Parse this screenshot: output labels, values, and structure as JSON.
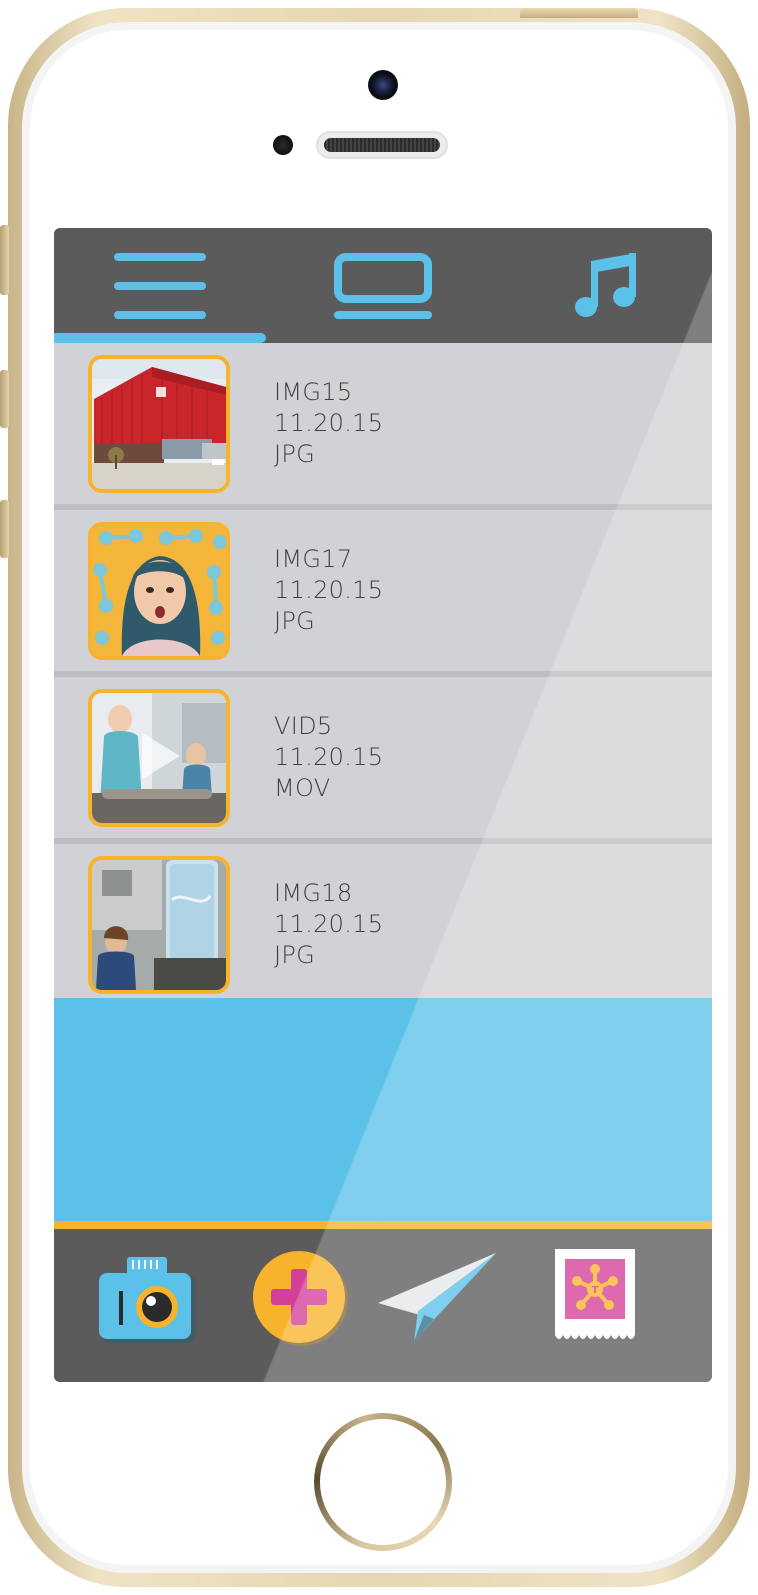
{
  "tabs": [
    {
      "id": "list",
      "icon": "menu-icon",
      "active": true
    },
    {
      "id": "screen",
      "icon": "screen-icon",
      "active": false
    },
    {
      "id": "music",
      "icon": "music-note-icon",
      "active": false
    }
  ],
  "media": [
    {
      "name": "IMG15",
      "date": "11.20.15",
      "type": "JPG",
      "thumbnail": "building-photo"
    },
    {
      "name": "IMG17",
      "date": "11.20.15",
      "type": "JPG",
      "thumbnail": "girl-photo"
    },
    {
      "name": "VID5",
      "date": "11.20.15",
      "type": "MOV",
      "thumbnail": "kids-video",
      "play_icon": "play-icon"
    },
    {
      "name": "IMG18",
      "date": "11.20.15",
      "type": "JPG",
      "thumbnail": "water-tank-photo"
    }
  ],
  "toolbar": {
    "items": [
      {
        "id": "camera",
        "icon": "camera-icon"
      },
      {
        "id": "add",
        "icon": "plus-icon",
        "selected": true
      },
      {
        "id": "send",
        "icon": "paper-plane-icon"
      },
      {
        "id": "ticket",
        "icon": "ticket-icon"
      }
    ]
  },
  "colors": {
    "accent_blue": "#5bc1e8",
    "accent_orange": "#f7b32b",
    "magenta": "#d43f97",
    "bar_gray": "#5b5b5b",
    "row_gray": "#d1d2d5"
  }
}
